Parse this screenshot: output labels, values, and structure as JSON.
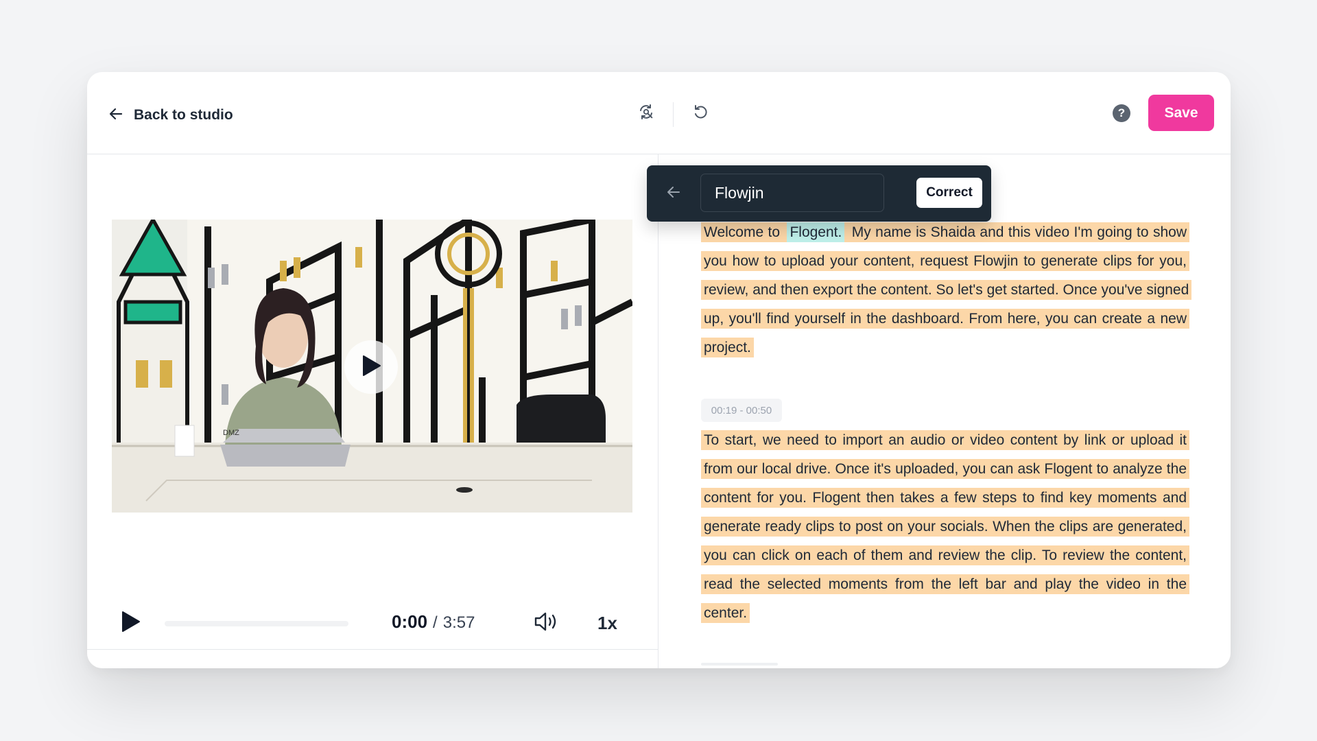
{
  "header": {
    "back_label": "Back to studio",
    "save_label": "Save",
    "help_label": "?"
  },
  "player": {
    "current_time": "0:00",
    "time_separator": "/",
    "duration": "3:57",
    "speed": "1x",
    "progress": 0
  },
  "correction_popup": {
    "input_value": "Flowjin",
    "button_label": "Correct"
  },
  "transcript": {
    "segments": [
      {
        "timestamp": "",
        "highlighted_word": "Flogent.",
        "before": "Welcome to ",
        "after": " My name is Shaida and this video I'm going to show you how to upload your content, request Flowjin to generate clips for you, review, and then export the content. So let's get started. Once you've signed up, you'll find yourself in the dashboard. From here, you can create a new project."
      },
      {
        "timestamp": "00:19 - 00:50",
        "text": "To start, we need to import an audio or video content by link or upload it from our local drive. Once it's uploaded, you can ask Flogent to analyze the content for you. Flogent then takes a few steps to find key moments and generate ready clips to post on your socials. When the clips are generated, you can click on each of them and review the clip. To review the content, read the selected moments from the left bar and play the video in the center."
      }
    ]
  },
  "colors": {
    "accent": "#f0399e",
    "transcript_highlight": "#fcd7a8",
    "word_highlight": "#bff0ea",
    "popup_bg": "#1e2a35"
  },
  "icons": {
    "back": "arrow-left-icon",
    "find_replace": "find-replace-icon",
    "undo": "undo-icon",
    "help": "help-icon",
    "play": "play-icon",
    "volume": "volume-icon"
  }
}
